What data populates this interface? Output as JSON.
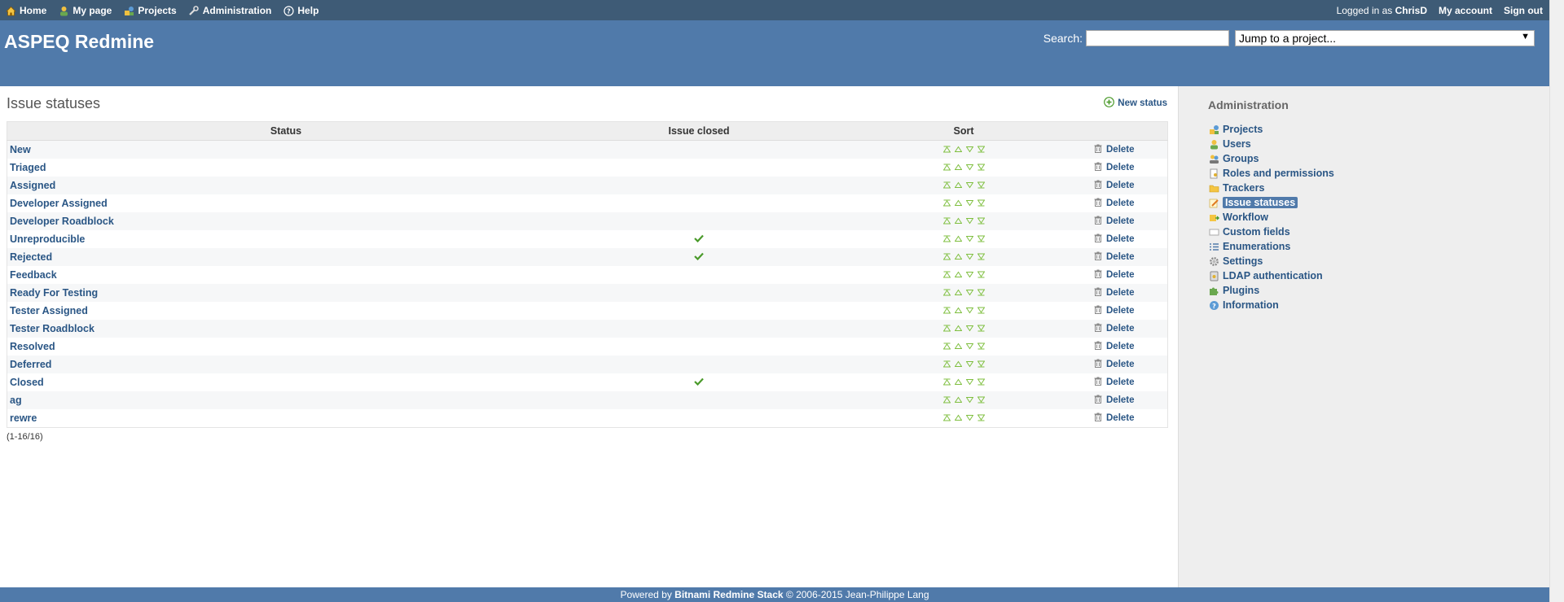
{
  "top_menu": {
    "items": [
      {
        "label": "Home",
        "icon": "home-icon"
      },
      {
        "label": "My page",
        "icon": "user-icon"
      },
      {
        "label": "Projects",
        "icon": "projects-icon"
      },
      {
        "label": "Administration",
        "icon": "wrench-icon"
      },
      {
        "label": "Help",
        "icon": "help-icon"
      }
    ],
    "logged_in_prefix": "Logged in as",
    "user": "ChrisD",
    "my_account": "My account",
    "sign_out": "Sign out"
  },
  "header": {
    "title": "ASPEQ Redmine",
    "search_label": "Search:",
    "search_value": "",
    "jump_label": "Jump to a project..."
  },
  "content": {
    "title": "Issue statuses",
    "new_status": "New status",
    "columns": [
      "Status",
      "Issue closed",
      "Sort",
      ""
    ],
    "delete_label": "Delete",
    "rows": [
      {
        "name": "New",
        "closed": false
      },
      {
        "name": "Triaged",
        "closed": false
      },
      {
        "name": "Assigned",
        "closed": false
      },
      {
        "name": "Developer Assigned",
        "closed": false
      },
      {
        "name": "Developer Roadblock",
        "closed": false
      },
      {
        "name": "Unreproducible",
        "closed": true
      },
      {
        "name": "Rejected",
        "closed": true
      },
      {
        "name": "Feedback",
        "closed": false
      },
      {
        "name": "Ready For Testing",
        "closed": false
      },
      {
        "name": "Tester Assigned",
        "closed": false
      },
      {
        "name": "Tester Roadblock",
        "closed": false
      },
      {
        "name": "Resolved",
        "closed": false
      },
      {
        "name": "Deferred",
        "closed": false
      },
      {
        "name": "Closed",
        "closed": true
      },
      {
        "name": "ag",
        "closed": false
      },
      {
        "name": "rewre",
        "closed": false
      }
    ],
    "pagination": "(1-16/16)"
  },
  "sidebar": {
    "title": "Administration",
    "items": [
      {
        "label": "Projects",
        "icon": "projects-icon",
        "selected": false
      },
      {
        "label": "Users",
        "icon": "user-icon",
        "selected": false
      },
      {
        "label": "Groups",
        "icon": "group-icon",
        "selected": false
      },
      {
        "label": "Roles and permissions",
        "icon": "key-icon",
        "selected": false
      },
      {
        "label": "Trackers",
        "icon": "folder-icon",
        "selected": false
      },
      {
        "label": "Issue statuses",
        "icon": "pencil-icon",
        "selected": true
      },
      {
        "label": "Workflow",
        "icon": "workflow-icon",
        "selected": false
      },
      {
        "label": "Custom fields",
        "icon": "field-icon",
        "selected": false
      },
      {
        "label": "Enumerations",
        "icon": "list-icon",
        "selected": false
      },
      {
        "label": "Settings",
        "icon": "gear-icon",
        "selected": false
      },
      {
        "label": "LDAP authentication",
        "icon": "server-icon",
        "selected": false
      },
      {
        "label": "Plugins",
        "icon": "puzzle-icon",
        "selected": false
      },
      {
        "label": "Information",
        "icon": "info-icon",
        "selected": false
      }
    ]
  },
  "footer": {
    "prefix": "Powered by",
    "product": "Bitnami Redmine Stack",
    "suffix": "© 2006-2015 Jean-Philippe Lang"
  },
  "colors": {
    "top_menu": "#3E5B76",
    "header": "#507AAA",
    "link": "#2A5685",
    "sort_arrow": "#7fbf3f",
    "check": "#4a9a2a"
  }
}
